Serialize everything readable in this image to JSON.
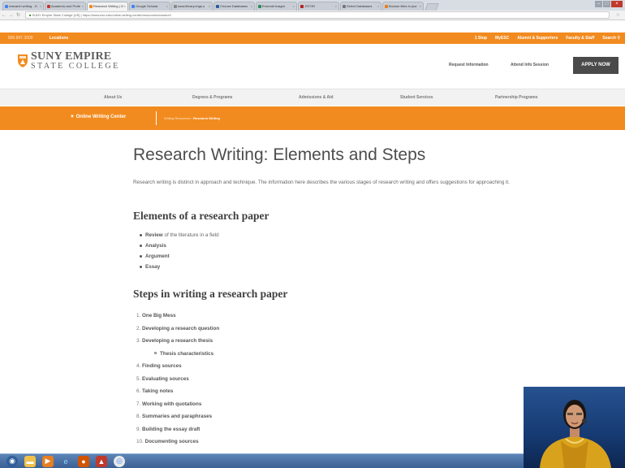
{
  "browser": {
    "tabs": [
      {
        "label": "research writing - G",
        "favicon_color": "#4285f4",
        "active": false
      },
      {
        "label": "Academic and Profe",
        "favicon_color": "#c0392b",
        "active": false
      },
      {
        "label": "Research Writing | O",
        "favicon_color": "#f28b1f",
        "active": true
      },
      {
        "label": "Google Scholar",
        "favicon_color": "#4285f4",
        "active": false
      },
      {
        "label": "www.library.nhgs.o",
        "favicon_color": "#888888",
        "active": false
      },
      {
        "label": "Choose Databases",
        "favicon_color": "#2c5aa0",
        "active": false
      },
      {
        "label": "Emerald Insight",
        "favicon_color": "#2e8b57",
        "active": false
      },
      {
        "label": "JSTOR",
        "favicon_color": "#b22222",
        "active": false
      },
      {
        "label": "Select Databases",
        "favicon_color": "#777777",
        "active": false
      },
      {
        "label": "Browse titles in jour",
        "favicon_color": "#e67e22",
        "active": false
      }
    ],
    "url_site": "SUNY Empire State College [US]",
    "url": "https://www.esc.edu/online-writing-center/resources/research/"
  },
  "topbar": {
    "phone": "800.847.3000",
    "locations": "Locations",
    "links": [
      "1 Stop",
      "MyESC",
      "Alumni & Supporters",
      "Faculty & Staff",
      "Search"
    ]
  },
  "header": {
    "logo_line1": "SUNY EMPIRE",
    "logo_line2": "STATE COLLEGE",
    "request_info": "Request Information",
    "attend_info": "Attend Info Session",
    "apply": "APPLY NOW"
  },
  "mainnav": [
    "About Us",
    "Degrees & Programs",
    "Admissions & Aid",
    "Student Services",
    "Partnership Programs"
  ],
  "subbar": {
    "section": "Online Writing Center",
    "crumb_parent": "Writing Resources",
    "crumb_current": "Research Writing"
  },
  "content": {
    "title": "Research Writing: Elements and Steps",
    "intro": "Research writing is distinct in approach and technique. The information here describes the various stages of research writing and offers suggestions for approaching it.",
    "elements_heading_pre": "Elements of ",
    "elements_heading_bold": "a research paper",
    "elements": [
      {
        "bold": "Review",
        "rest": " of the literature in a field"
      },
      {
        "bold": "Analysis",
        "rest": ""
      },
      {
        "bold": "Argument",
        "rest": ""
      },
      {
        "bold": "Essay",
        "rest": ""
      }
    ],
    "steps_heading": "Steps in writing a research paper",
    "steps": [
      {
        "num": "1.",
        "label": "One Big Mess"
      },
      {
        "num": "2.",
        "label": "Developing a research question"
      },
      {
        "num": "3.",
        "label": "Developing a research thesis"
      },
      {
        "num": "",
        "label": "Thesis characteristics",
        "sub": true
      },
      {
        "num": "4.",
        "label": "Finding sources"
      },
      {
        "num": "5.",
        "label": "Evaluating sources"
      },
      {
        "num": "6.",
        "label": "Taking notes"
      },
      {
        "num": "7.",
        "label": "Working with quotations"
      },
      {
        "num": "8.",
        "label": "Summaries and paraphrases"
      },
      {
        "num": "9.",
        "label": "Building the essay draft"
      },
      {
        "num": "10.",
        "label": "Documenting sources"
      }
    ]
  },
  "colors": {
    "accent": "#f28b1f",
    "apply_bg": "#4a4a4a"
  }
}
